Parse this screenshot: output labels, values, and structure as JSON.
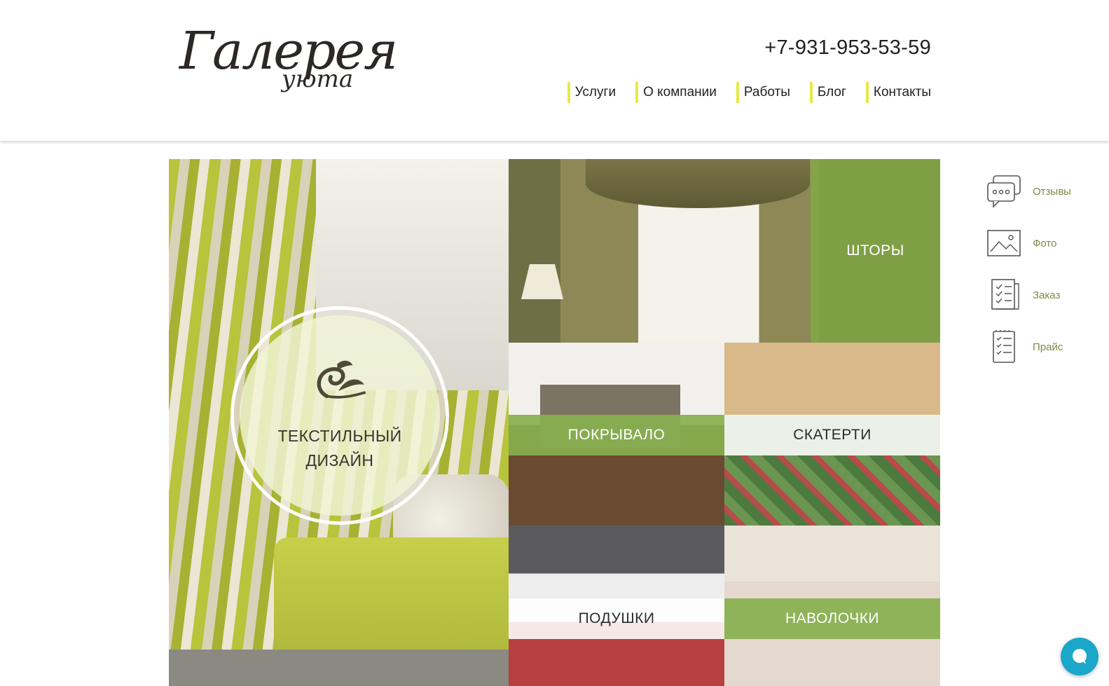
{
  "brand": {
    "logo_main": "Галерея",
    "logo_sub": "уюта"
  },
  "header": {
    "phone": "+7-931-953-53-59",
    "nav": [
      "Услуги",
      "О компании",
      "Работы",
      "Блог",
      "Контакты"
    ]
  },
  "tiles": {
    "main": {
      "label_line1": "ТЕКСТИЛЬНЫЙ",
      "label_line2": "ДИЗАЙН"
    },
    "curtains": "ШТОРЫ",
    "bedspread": "ПОКРЫВАЛО",
    "tablecloths": "СКАТЕРТИ",
    "pillows": "ПОДУШКИ",
    "pillowcases": "НАВОЛОЧКИ"
  },
  "sidebar": {
    "items": [
      {
        "label": "Отзывы",
        "icon": "chat-bubble-icon"
      },
      {
        "label": "Фото",
        "icon": "image-icon"
      },
      {
        "label": "Заказ",
        "icon": "order-list-icon"
      },
      {
        "label": "Прайс",
        "icon": "price-list-icon"
      }
    ]
  },
  "colors": {
    "accent_green": "#88b04e",
    "nav_marker": "#e6e94a",
    "chat_button": "#1aa7c9",
    "sidebar_text": "#7f8a4b"
  }
}
